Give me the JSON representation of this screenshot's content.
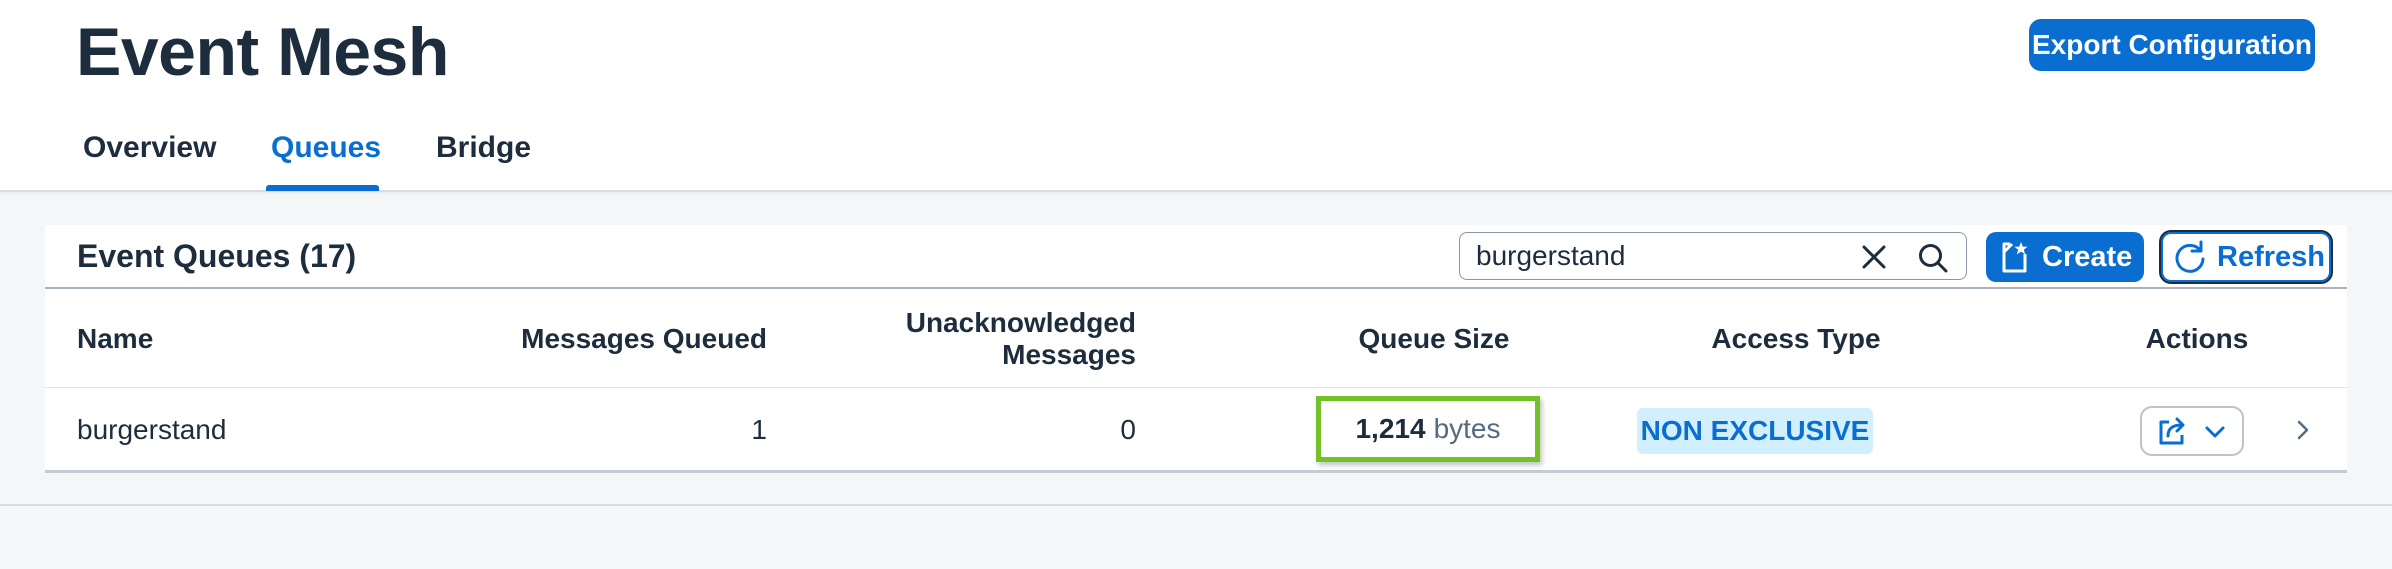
{
  "app": {
    "title": "Event Mesh",
    "export_label": "Export Configuration"
  },
  "tabs": [
    {
      "label": "Overview",
      "active": false
    },
    {
      "label": "Queues",
      "active": true
    },
    {
      "label": "Bridge",
      "active": false
    }
  ],
  "queues_panel": {
    "title": "Event Queues (17)",
    "search": {
      "value": "burgerstand",
      "placeholder": ""
    },
    "create_label": "Create",
    "refresh_label": "Refresh"
  },
  "table": {
    "columns": {
      "name": "Name",
      "messages_queued": "Messages Queued",
      "unacked_line1": "Unacknowledged",
      "unacked_line2": "Messages",
      "queue_size": "Queue Size",
      "access_type": "Access Type",
      "actions": "Actions"
    },
    "rows": [
      {
        "name": "burgerstand",
        "messages_queued": "1",
        "unacknowledged": "0",
        "queue_size_value": "1,214",
        "queue_size_unit": "bytes",
        "access_type": "NON EXCLUSIVE"
      }
    ]
  },
  "colors": {
    "accent": "#0a6ed1",
    "highlight": "#73c027",
    "badge_bg": "#d1efff"
  },
  "icons": [
    "clear-icon",
    "search-icon",
    "create-icon",
    "refresh-icon",
    "share-icon",
    "chevron-down-icon",
    "chevron-right-icon"
  ]
}
